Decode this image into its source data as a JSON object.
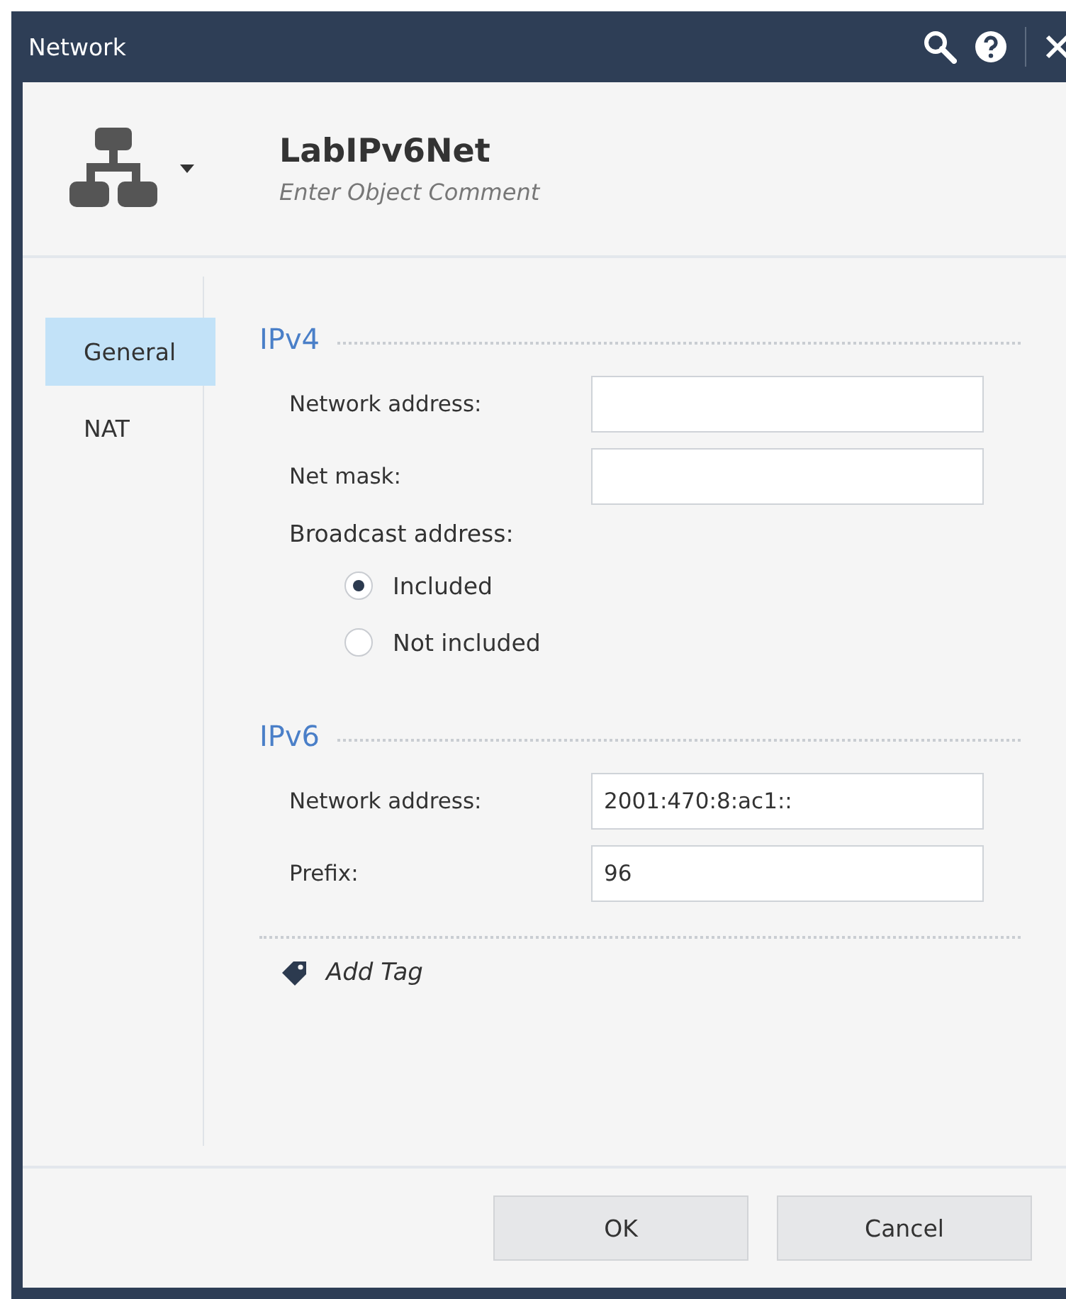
{
  "window": {
    "title": "Network"
  },
  "object": {
    "name": "LabIPv6Net",
    "comment": {
      "placeholder": "Enter Object Comment"
    }
  },
  "sidebar": {
    "items": [
      {
        "label": "General",
        "selected": true
      },
      {
        "label": "NAT",
        "selected": false
      }
    ]
  },
  "sections": [
    {
      "title": "IPv4",
      "fields": [
        {
          "label": "Network address:"
        },
        {
          "label": "Net mask:"
        }
      ],
      "broadcast": {
        "label": "Broadcast address:",
        "options": [
          {
            "label": "Included",
            "selected": true
          },
          {
            "label": "Not included",
            "selected": false
          }
        ]
      }
    },
    {
      "title": "IPv6",
      "fields": [
        {
          "label": "Network address:",
          "value": "2001:470:8:ac1::"
        },
        {
          "label": "Prefix:",
          "value": "96"
        }
      ]
    }
  ],
  "add_tag": "Add Tag",
  "buttons": [
    "OK",
    "Cancel"
  ]
}
